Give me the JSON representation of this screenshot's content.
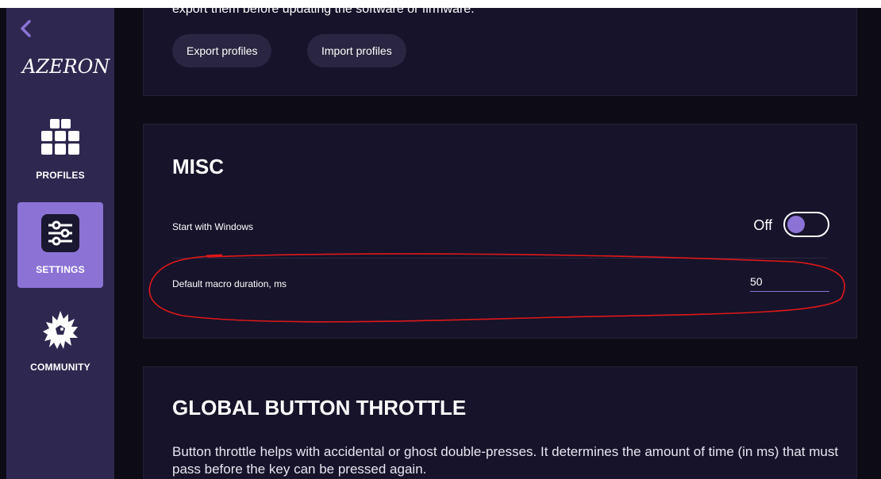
{
  "sidebar": {
    "logo_text": "AZERON",
    "items": [
      {
        "label": "PROFILES",
        "icon": "grid-icon"
      },
      {
        "label": "SETTINGS",
        "icon": "sliders-icon",
        "active": true
      },
      {
        "label": "COMMUNITY",
        "icon": "dragon-icon"
      }
    ]
  },
  "profiles_section": {
    "partial_text": "export them before updating the software or firmware.",
    "export_label": "Export profiles",
    "import_label": "Import profiles"
  },
  "misc": {
    "title": "MISC",
    "start_with_windows_label": "Start with Windows",
    "start_with_windows_state": "Off",
    "macro_duration_label": "Default macro duration, ms",
    "macro_duration_value": "50"
  },
  "throttle": {
    "title": "GLOBAL BUTTON THROTTLE",
    "description": "Button throttle helps with accidental or ghost double-presses. It determines the amount of time (in ms) that must pass before the key can be pressed again."
  },
  "colors": {
    "accent": "#8b73d6",
    "sidebar_bg": "#2e2850",
    "panel_bg": "#16132a",
    "annotation": "#e01818"
  }
}
